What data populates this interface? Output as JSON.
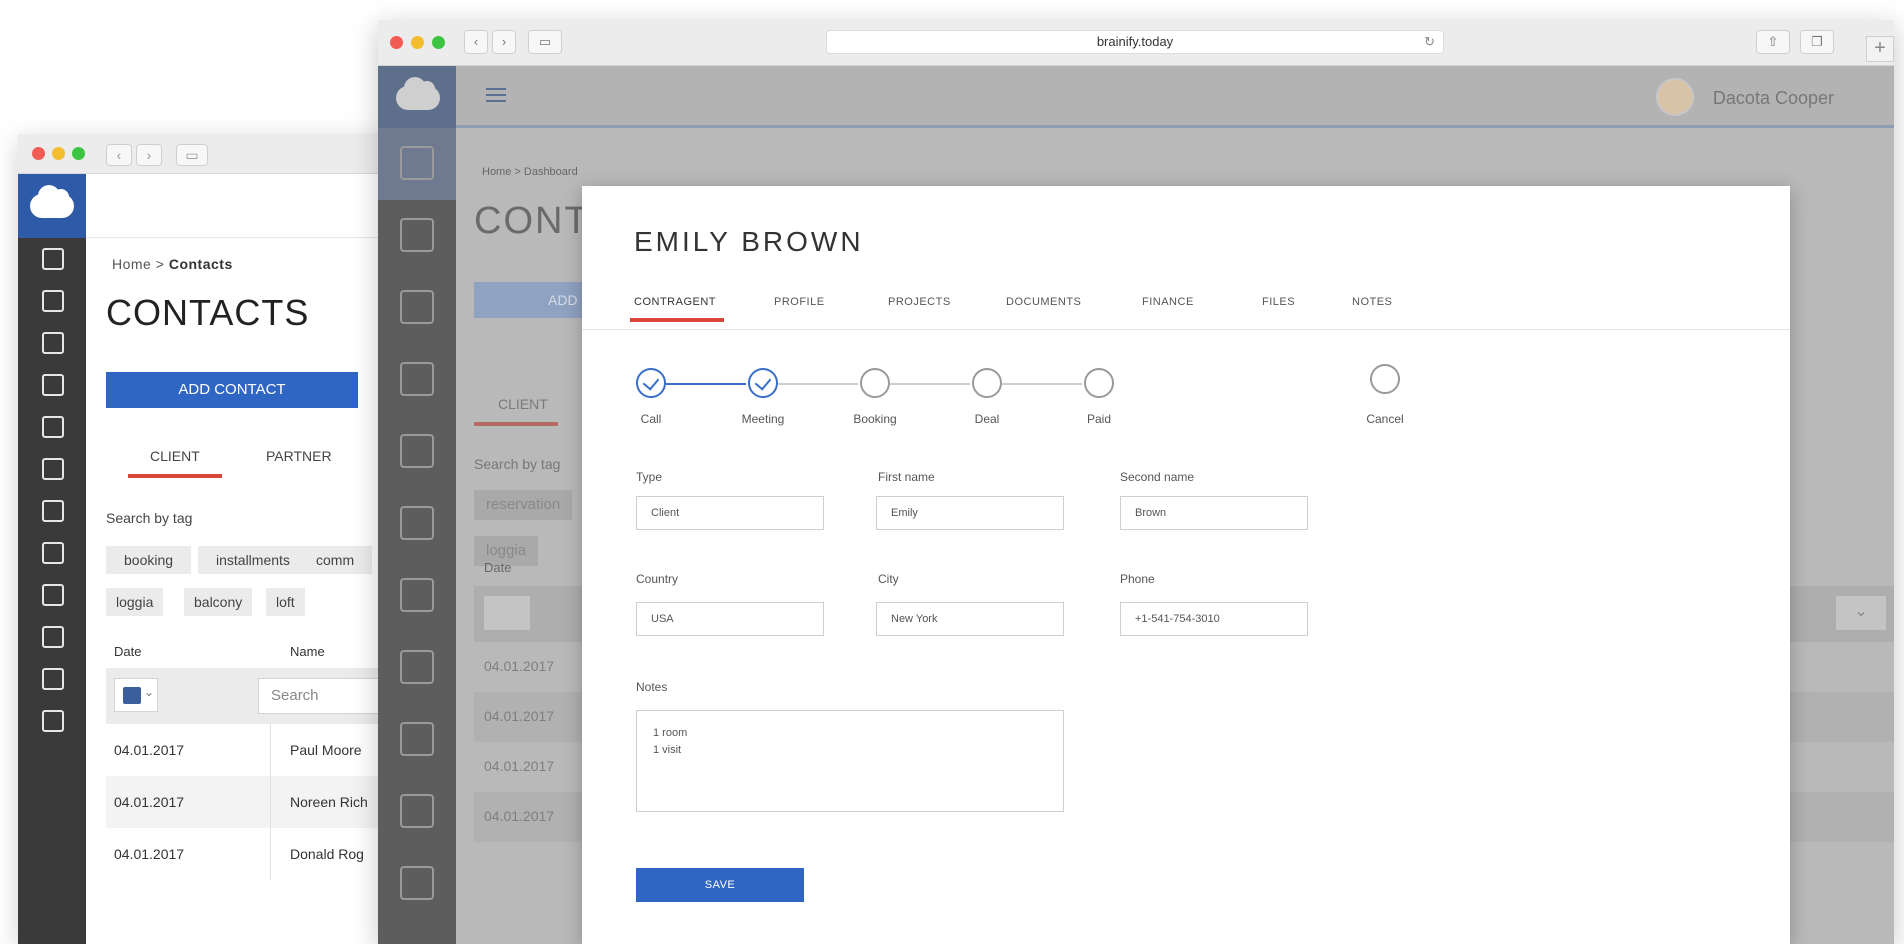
{
  "back_window": {
    "breadcrumb_home": "Home",
    "breadcrumb_sep": ">",
    "breadcrumb_current": "Contacts",
    "title": "CONTACTS",
    "add_contact_label": "ADD CONTACT",
    "tabs": [
      {
        "label": "CLIENT",
        "active": true
      },
      {
        "label": "PARTNER",
        "active": false
      }
    ],
    "search_by_tag_label": "Search by tag",
    "tags": [
      "booking",
      "installments",
      "comm",
      "loggia",
      "balcony",
      "loft"
    ],
    "columns": [
      "Date",
      "Name"
    ],
    "search_placeholder": "Search",
    "rows": [
      {
        "date": "04.01.2017",
        "name": "Paul Moore"
      },
      {
        "date": "04.01.2017",
        "name": "Noreen Rich"
      },
      {
        "date": "04.01.2017",
        "name": "Donald Rog"
      }
    ]
  },
  "front_window": {
    "url": "brainify.today",
    "user_name": "Dacota Cooper",
    "dim": {
      "breadcrumb": "Home  >  Dashboard",
      "title": "CONT",
      "add_label": "ADD",
      "tab_label": "CLIENT",
      "search_label": "Search by tag",
      "tags": [
        "reservation",
        "loggia"
      ],
      "date_label": "Date",
      "rows": [
        "04.01.2017",
        "04.01.2017",
        "04.01.2017",
        "04.01.2017"
      ]
    }
  },
  "modal": {
    "title": "EMILY  BROWN",
    "tabs": [
      {
        "label": "CONTRAGENT",
        "active": true
      },
      {
        "label": "PROFILE",
        "active": false
      },
      {
        "label": "PROJECTS",
        "active": false
      },
      {
        "label": "DOCUMENTS",
        "active": false
      },
      {
        "label": "FINANCE",
        "active": false
      },
      {
        "label": "FILES",
        "active": false
      },
      {
        "label": "NOTES",
        "active": false
      }
    ],
    "steps": [
      {
        "label": "Call",
        "done": true
      },
      {
        "label": "Meeting",
        "done": true
      },
      {
        "label": "Booking",
        "done": false
      },
      {
        "label": "Deal",
        "done": false
      },
      {
        "label": "Paid",
        "done": false
      },
      {
        "label": "Cancel",
        "done": false
      }
    ],
    "fields": {
      "type_label": "Type",
      "type_value": "Client",
      "first_name_label": "First name",
      "first_name_value": "Emily",
      "second_name_label": "Second name",
      "second_name_value": "Brown",
      "country_label": "Country",
      "country_value": "USA",
      "city_label": "City",
      "city_value": "New York",
      "phone_label": "Phone",
      "phone_value": "+1-541-754-3010",
      "notes_label": "Notes",
      "notes_line1": "1 room",
      "notes_line2": "1 visit"
    },
    "save_label": "SAVE",
    "accent": "#2f66c4",
    "tab_accent": "#d9473a"
  }
}
